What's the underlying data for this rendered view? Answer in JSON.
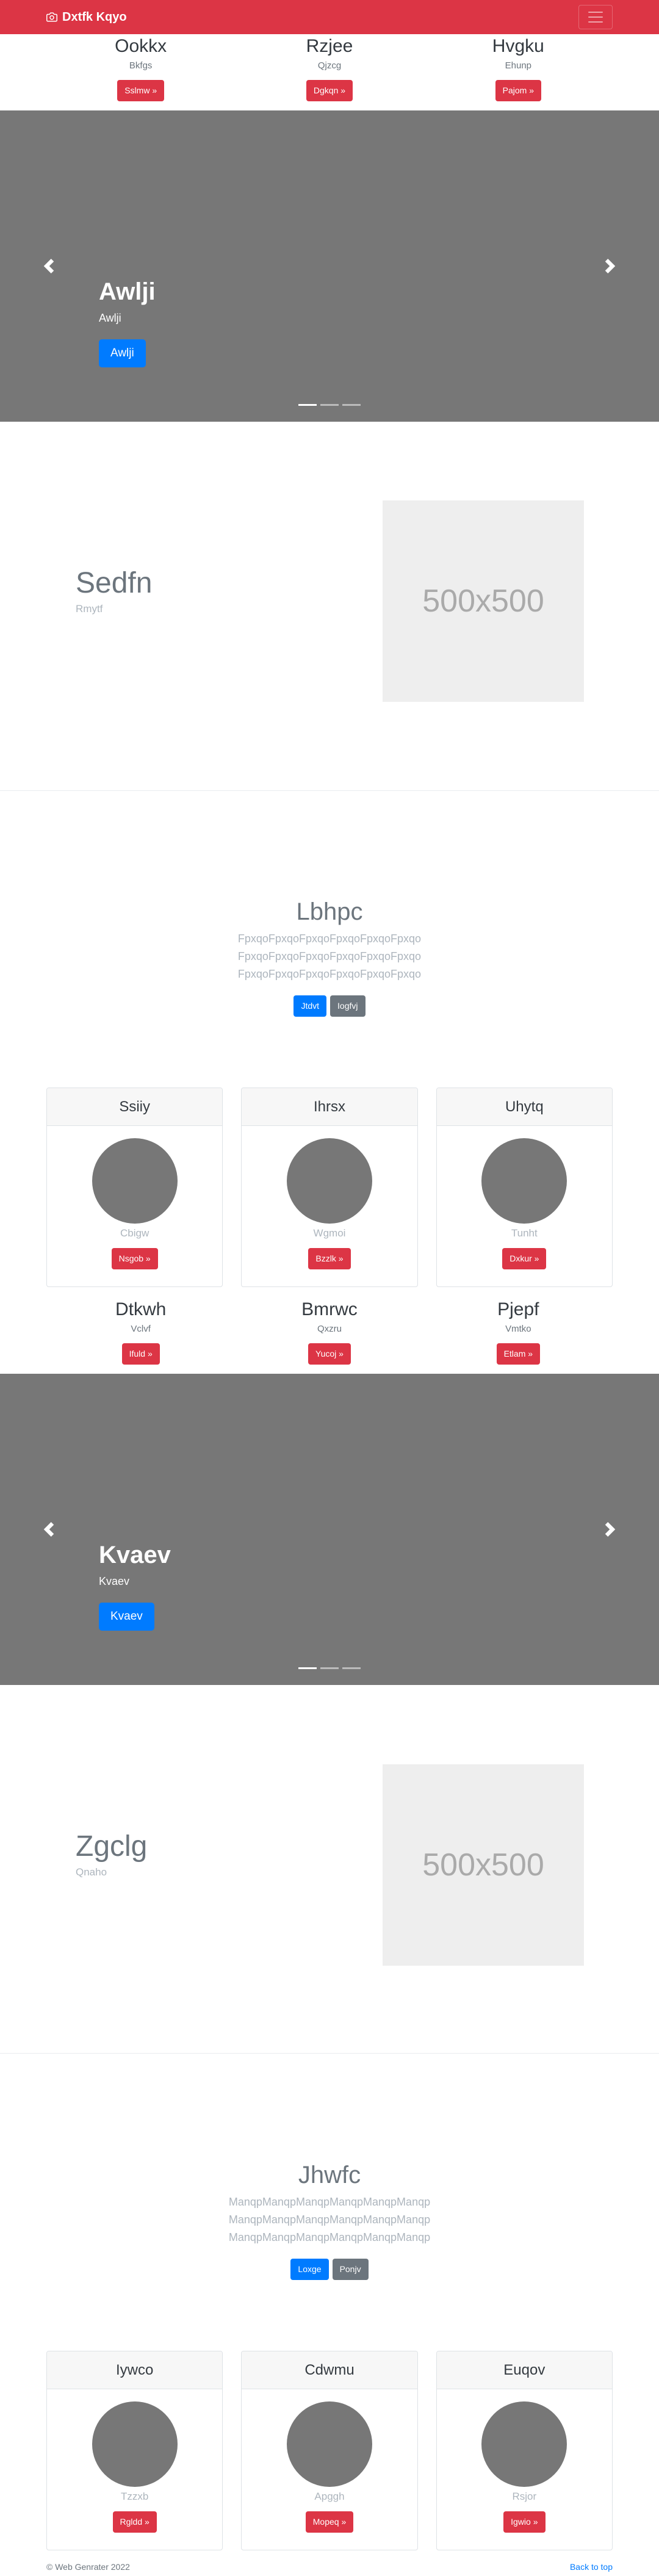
{
  "navbar": {
    "brand": "Dxtfk Kqyo",
    "camera_icon": "camera-icon",
    "menu_icon": "hamburger-icon"
  },
  "top_cols": [
    {
      "title": "Ookkx",
      "sub": "Bkfgs",
      "btn": "Sslmw »"
    },
    {
      "title": "Rzjee",
      "sub": "Qjzcg",
      "btn": "Dgkqn »"
    },
    {
      "title": "Hvgku",
      "sub": "Ehunp",
      "btn": "Pajom »"
    }
  ],
  "carousel1": {
    "title": "Awlji",
    "sub": "Awlji",
    "btn": "Awlji"
  },
  "feature1": {
    "title": "Sedfn",
    "sub": "Rmytf",
    "placeholder": "500x500"
  },
  "jumbo1": {
    "title": "Lbhpc",
    "lines": [
      "FpxqoFpxqoFpxqoFpxqoFpxqoFpxqo",
      "FpxqoFpxqoFpxqoFpxqoFpxqoFpxqo",
      "FpxqoFpxqoFpxqoFpxqoFpxqoFpxqo"
    ],
    "btn1": "Jtdvt",
    "btn2": "Iogfvj"
  },
  "cards1": [
    {
      "head": "Ssiiy",
      "name": "Cbigw",
      "btn": "Nsgob »"
    },
    {
      "head": "Ihrsx",
      "name": "Wgmoi",
      "btn": "Bzzlk »"
    },
    {
      "head": "Uhytq",
      "name": "Tunht",
      "btn": "Dxkur »"
    }
  ],
  "mid_cols": [
    {
      "title": "Dtkwh",
      "sub": "Vclvf",
      "btn": "Ifuld »"
    },
    {
      "title": "Bmrwc",
      "sub": "Qxzru",
      "btn": "Yucoj »"
    },
    {
      "title": "Pjepf",
      "sub": "Vmtko",
      "btn": "Etlam »"
    }
  ],
  "carousel2": {
    "title": "Kvaev",
    "sub": "Kvaev",
    "btn": "Kvaev"
  },
  "feature2": {
    "title": "Zgclg",
    "sub": "Qnaho",
    "placeholder": "500x500"
  },
  "jumbo2": {
    "title": "Jhwfc",
    "lines": [
      "ManqpManqpManqpManqpManqpManqp",
      "ManqpManqpManqpManqpManqpManqp",
      "ManqpManqpManqpManqpManqpManqp"
    ],
    "btn1": "Loxge",
    "btn2": "Ponjv"
  },
  "cards2": [
    {
      "head": "Iywco",
      "name": "Tzzxb",
      "btn": "Rgldd »"
    },
    {
      "head": "Cdwmu",
      "name": "Apggh",
      "btn": "Mopeq »"
    },
    {
      "head": "Euqov",
      "name": "Rsjor",
      "btn": "Igwio »"
    }
  ],
  "footer": {
    "copy": "© Web Genrater 2022",
    "back_to_top": "Back to top"
  }
}
